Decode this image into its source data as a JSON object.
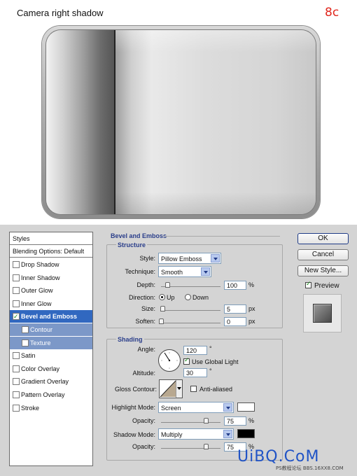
{
  "illustration": {
    "caption": "Camera right shadow",
    "step_number": "8c"
  },
  "styles_panel": {
    "header": "Styles",
    "items": [
      {
        "label": "Blending Options: Default",
        "has_checkbox": false,
        "checked": false
      },
      {
        "label": "Drop Shadow",
        "has_checkbox": true,
        "checked": false
      },
      {
        "label": "Inner Shadow",
        "has_checkbox": true,
        "checked": false
      },
      {
        "label": "Outer Glow",
        "has_checkbox": true,
        "checked": false
      },
      {
        "label": "Inner Glow",
        "has_checkbox": true,
        "checked": false
      },
      {
        "label": "Bevel and Emboss",
        "has_checkbox": true,
        "checked": true,
        "selected": true
      },
      {
        "label": "Contour",
        "has_checkbox": true,
        "checked": false,
        "sub": true
      },
      {
        "label": "Texture",
        "has_checkbox": true,
        "checked": false,
        "sub": true
      },
      {
        "label": "Satin",
        "has_checkbox": true,
        "checked": false
      },
      {
        "label": "Color Overlay",
        "has_checkbox": true,
        "checked": false
      },
      {
        "label": "Gradient Overlay",
        "has_checkbox": true,
        "checked": false
      },
      {
        "label": "Pattern Overlay",
        "has_checkbox": true,
        "checked": false
      },
      {
        "label": "Stroke",
        "has_checkbox": true,
        "checked": false
      }
    ]
  },
  "bevel": {
    "title": "Bevel and Emboss",
    "structure": {
      "title": "Structure",
      "style_label": "Style:",
      "style_value": "Pillow Emboss",
      "technique_label": "Technique:",
      "technique_value": "Smooth",
      "depth_label": "Depth:",
      "depth_value": "100",
      "depth_unit": "%",
      "depth_slider": 0.1,
      "direction_label": "Direction:",
      "direction_up": "Up",
      "direction_down": "Down",
      "direction_selected": "Up",
      "size_label": "Size:",
      "size_value": "5",
      "size_unit": "px",
      "size_slider": 0.02,
      "soften_label": "Soften:",
      "soften_value": "0",
      "soften_unit": "px",
      "soften_slider": 0.0
    },
    "shading": {
      "title": "Shading",
      "angle_label": "Angle:",
      "angle_value": "120",
      "angle_unit": "°",
      "global_light_label": "Use Global Light",
      "global_light_checked": true,
      "altitude_label": "Altitude:",
      "altitude_value": "30",
      "altitude_unit": "°",
      "gloss_label": "Gloss Contour:",
      "anti_aliased_label": "Anti-aliased",
      "anti_aliased_checked": false,
      "highlight_mode_label": "Highlight Mode:",
      "highlight_mode_value": "Screen",
      "highlight_color": "#ffffff",
      "highlight_opacity_label": "Opacity:",
      "highlight_opacity_value": "75",
      "highlight_opacity_unit": "%",
      "highlight_opacity_slider": 0.75,
      "shadow_mode_label": "Shadow Mode:",
      "shadow_mode_value": "Multiply",
      "shadow_color": "#000000",
      "shadow_opacity_label": "Opacity:",
      "shadow_opacity_value": "75",
      "shadow_opacity_unit": "%",
      "shadow_opacity_slider": 0.75
    }
  },
  "buttons": {
    "ok": "OK",
    "cancel": "Cancel",
    "new_style": "New Style...",
    "preview_label": "Preview",
    "preview_checked": true
  },
  "watermark": {
    "logo": "UiBQ.CoM",
    "url": "PS教程论坛  BBS.16XX8.COM"
  },
  "colors": {
    "selection": "#3168c0",
    "sub_selection": "#7c98c8",
    "group_title": "#2a3e8a",
    "step_red": "#e0261c"
  }
}
